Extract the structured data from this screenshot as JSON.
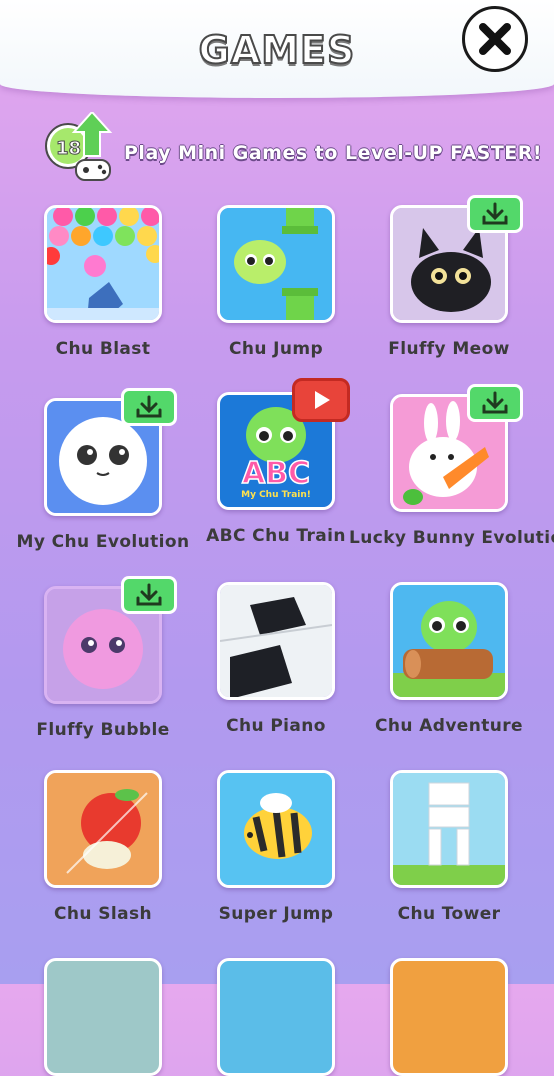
{
  "header": {
    "title": "GAMES"
  },
  "promo": {
    "level": "18",
    "text": "Play Mini Games to Level-UP FASTER!"
  },
  "games": [
    {
      "label": "Chu Blast",
      "badge": "none"
    },
    {
      "label": "Chu Jump",
      "badge": "none"
    },
    {
      "label": "Fluffy Meow",
      "badge": "download"
    },
    {
      "label": "My Chu Evolution",
      "badge": "download"
    },
    {
      "label": "ABC Chu Train",
      "badge": "play",
      "thumb_text": "ABC",
      "thumb_subtext": "My Chu Train!"
    },
    {
      "label": "Lucky Bunny Evolution",
      "badge": "download"
    },
    {
      "label": "Fluffy Bubble",
      "badge": "download"
    },
    {
      "label": "Chu Piano",
      "badge": "none"
    },
    {
      "label": "Chu Adventure",
      "badge": "none"
    },
    {
      "label": "Chu Slash",
      "badge": "none"
    },
    {
      "label": "Super Jump",
      "badge": "none"
    },
    {
      "label": "Chu Tower",
      "badge": "none"
    }
  ],
  "colors": {
    "download_badge": "#53d86a",
    "play_badge": "#e8443a",
    "label_text": "#3b3b3b"
  },
  "icons": {
    "close": "close-x-icon",
    "download": "download-icon",
    "play": "play-icon",
    "level": "level-up-arrow-icon"
  }
}
